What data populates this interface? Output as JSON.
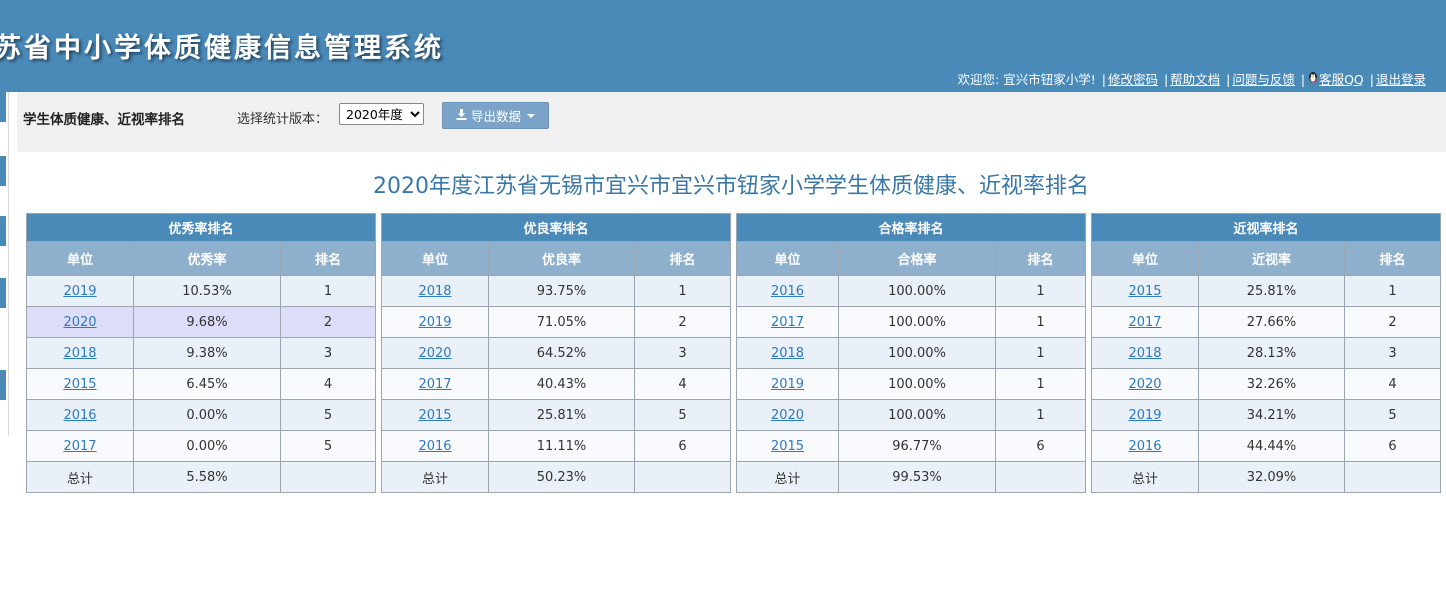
{
  "header": {
    "system_title": "苏省中小学体质健康信息管理系统",
    "welcome": "欢迎您: 宜兴市钮家小学!",
    "links": [
      "修改密码",
      "帮助文档",
      "问题与反馈",
      "客服QQ",
      "退出登录"
    ]
  },
  "toolbar": {
    "heading": "学生体质健康、近视率排名",
    "version_label": "选择统计版本：",
    "version_selected": "2020年度",
    "export_label": "导出数据"
  },
  "report": {
    "title": "2020年度江苏省无锡市宜兴市宜兴市钮家小学学生体质健康、近视率排名"
  },
  "tables": [
    {
      "caption": "优秀率排名",
      "columns": [
        "单位",
        "优秀率",
        "排名"
      ],
      "rows": [
        {
          "unit": "2019",
          "rate": "10.53%",
          "rank": "1"
        },
        {
          "unit": "2020",
          "rate": "9.68%",
          "rank": "2"
        },
        {
          "unit": "2018",
          "rate": "9.38%",
          "rank": "3"
        },
        {
          "unit": "2015",
          "rate": "6.45%",
          "rank": "4"
        },
        {
          "unit": "2016",
          "rate": "0.00%",
          "rank": "5"
        },
        {
          "unit": "2017",
          "rate": "0.00%",
          "rank": "5"
        }
      ],
      "total": {
        "label": "总计",
        "rate": "5.58%",
        "rank": ""
      }
    },
    {
      "caption": "优良率排名",
      "columns": [
        "单位",
        "优良率",
        "排名"
      ],
      "rows": [
        {
          "unit": "2018",
          "rate": "93.75%",
          "rank": "1"
        },
        {
          "unit": "2019",
          "rate": "71.05%",
          "rank": "2"
        },
        {
          "unit": "2020",
          "rate": "64.52%",
          "rank": "3"
        },
        {
          "unit": "2017",
          "rate": "40.43%",
          "rank": "4"
        },
        {
          "unit": "2015",
          "rate": "25.81%",
          "rank": "5"
        },
        {
          "unit": "2016",
          "rate": "11.11%",
          "rank": "6"
        }
      ],
      "total": {
        "label": "总计",
        "rate": "50.23%",
        "rank": ""
      }
    },
    {
      "caption": "合格率排名",
      "columns": [
        "单位",
        "合格率",
        "排名"
      ],
      "rows": [
        {
          "unit": "2016",
          "rate": "100.00%",
          "rank": "1"
        },
        {
          "unit": "2017",
          "rate": "100.00%",
          "rank": "1"
        },
        {
          "unit": "2018",
          "rate": "100.00%",
          "rank": "1"
        },
        {
          "unit": "2019",
          "rate": "100.00%",
          "rank": "1"
        },
        {
          "unit": "2020",
          "rate": "100.00%",
          "rank": "1"
        },
        {
          "unit": "2015",
          "rate": "96.77%",
          "rank": "6"
        }
      ],
      "total": {
        "label": "总计",
        "rate": "99.53%",
        "rank": ""
      }
    },
    {
      "caption": "近视率排名",
      "columns": [
        "单位",
        "近视率",
        "排名"
      ],
      "rows": [
        {
          "unit": "2015",
          "rate": "25.81%",
          "rank": "1"
        },
        {
          "unit": "2017",
          "rate": "27.66%",
          "rank": "2"
        },
        {
          "unit": "2018",
          "rate": "28.13%",
          "rank": "3"
        },
        {
          "unit": "2020",
          "rate": "32.26%",
          "rank": "4"
        },
        {
          "unit": "2019",
          "rate": "34.21%",
          "rank": "5"
        },
        {
          "unit": "2016",
          "rate": "44.44%",
          "rank": "6"
        }
      ],
      "total": {
        "label": "总计",
        "rate": "32.09%",
        "rank": ""
      }
    }
  ],
  "icons": {
    "qq": "qq-penguin-icon",
    "export": "download-icon",
    "select": "chevron-down-icon"
  },
  "colors": {
    "header_bg": "#4a8ab9",
    "table_caption_bg": "#4a8ab9",
    "table_column_bg": "#8fb0cc",
    "highlight_row": "#dddcf9",
    "link": "#2e7bbd"
  }
}
